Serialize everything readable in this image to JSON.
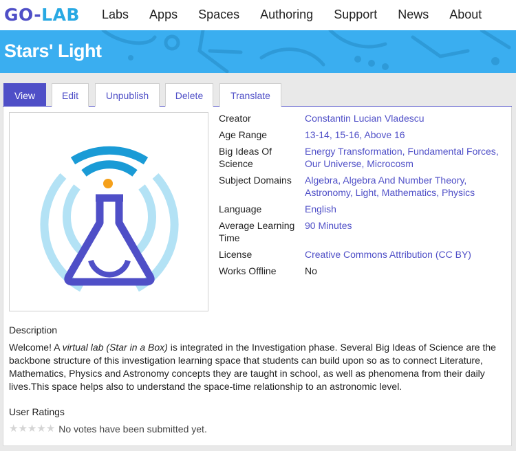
{
  "logo": {
    "go": "GO",
    "dash": "-",
    "lab": "LAB"
  },
  "nav": [
    "Labs",
    "Apps",
    "Spaces",
    "Authoring",
    "Support",
    "News",
    "About"
  ],
  "banner": {
    "title": "Stars' Light"
  },
  "tabs": [
    "View",
    "Edit",
    "Unpublish",
    "Delete",
    "Translate"
  ],
  "meta": {
    "creator_label": "Creator",
    "creator": "Constantin Lucian Vladescu",
    "age_label": "Age Range",
    "age": [
      "13-14",
      "15-16",
      "Above 16"
    ],
    "big_ideas_label": "Big Ideas Of Science",
    "big_ideas": [
      "Energy Transformation",
      "Fundamental Forces",
      "Our Universe",
      "Microcosm"
    ],
    "subject_label": "Subject Domains",
    "subjects": [
      "Algebra",
      "Algebra And Number Theory",
      "Astronomy",
      "Light",
      "Mathematics",
      "Physics"
    ],
    "language_label": "Language",
    "language": "English",
    "time_label": "Average Learning Time",
    "time": "90 Minutes",
    "license_label": "License",
    "license": "Creative Commons Attribution (CC BY)",
    "offline_label": "Works Offline",
    "offline": "No"
  },
  "description": {
    "title": "Description",
    "pre": "Welcome! A ",
    "italic": "virtual lab (Star in a Box)",
    "post": " is integrated in the Investigation phase. Several Big Ideas of Science are the backbone structure of this investigation learning space that students can build upon so as to connect Literature, Mathematics, Physics and Astronomy concepts they are taught in school, as well as phenomena from their daily lives.This space helps also to understand the space-time relationship to an astronomic level."
  },
  "ratings": {
    "title": "User Ratings",
    "stars": 0,
    "max": 5,
    "text": "No votes have been submitted yet."
  },
  "colors": {
    "accent": "#4f4fc7",
    "banner": "#3aaef0",
    "logo_lab": "#29a9e3",
    "icon_orange": "#f5a01a"
  }
}
